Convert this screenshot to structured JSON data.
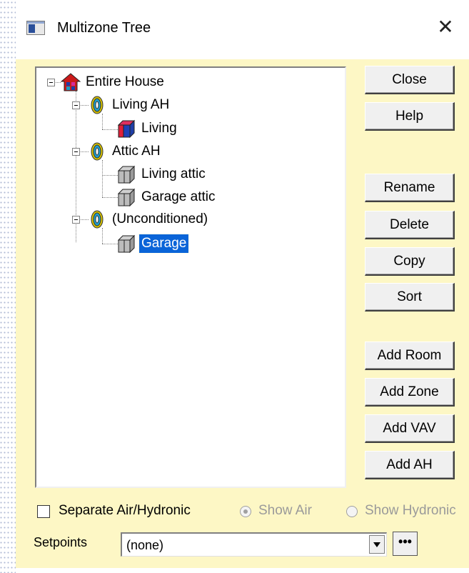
{
  "window": {
    "title": "Multizone Tree",
    "close_glyph": "✕"
  },
  "tree": {
    "nodes": [
      {
        "label": "Entire House",
        "icon": "house-icon"
      },
      {
        "label": "Living AH",
        "icon": "air-handler-icon"
      },
      {
        "label": "Living",
        "icon": "conditioned-room-icon"
      },
      {
        "label": "Attic AH",
        "icon": "air-handler-icon"
      },
      {
        "label": "Living attic",
        "icon": "unconditioned-room-icon"
      },
      {
        "label": "Garage attic",
        "icon": "unconditioned-room-icon"
      },
      {
        "label": "(Unconditioned)",
        "icon": "air-handler-icon"
      },
      {
        "label": "Garage",
        "icon": "unconditioned-room-icon",
        "selected": true
      }
    ]
  },
  "buttons": {
    "close": "Close",
    "help": "Help",
    "rename": "Rename",
    "delete": "Delete",
    "copy": "Copy",
    "sort": "Sort",
    "add_room": "Add Room",
    "add_zone": "Add Zone",
    "add_vav": "Add VAV",
    "add_ah": "Add AH"
  },
  "options": {
    "separate_label": "Separate Air/Hydronic",
    "separate_checked": false,
    "show_air_label": "Show Air",
    "show_air_selected": true,
    "show_hydronic_label": "Show Hydronic",
    "show_hydronic_selected": false
  },
  "setpoints": {
    "label": "Setpoints",
    "value": "(none)",
    "browse_label": "•••"
  },
  "colors": {
    "client_bg": "#fdf7c5",
    "selection": "#0a64d8"
  }
}
